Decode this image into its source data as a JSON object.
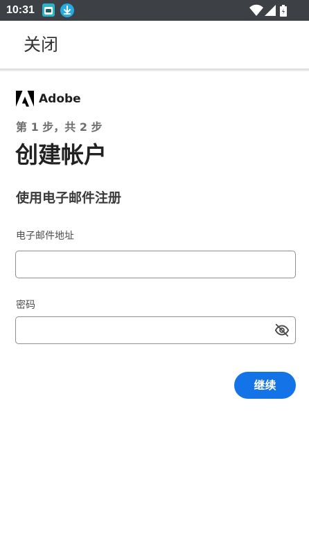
{
  "status_bar": {
    "time": "10:31",
    "notification_icons": [
      "app-notification-icon",
      "download-icon"
    ],
    "system_icons": [
      "wifi-icon",
      "cellular-signal-icon",
      "battery-icon"
    ]
  },
  "app_bar": {
    "close_label": "关闭"
  },
  "brand": {
    "name": "Adobe",
    "color": "#000000"
  },
  "form": {
    "step_label": "第 1 步，共 2 步",
    "title": "创建帐户",
    "section_heading": "使用电子邮件注册",
    "email": {
      "label": "电子邮件地址",
      "value": "",
      "placeholder": ""
    },
    "password": {
      "label": "密码",
      "value": "",
      "placeholder": "",
      "toggle_icon": "eye-off-icon"
    },
    "continue_label": "继续"
  },
  "colors": {
    "accent": "#1473e6",
    "status_bar_bg": "#3d4045"
  }
}
